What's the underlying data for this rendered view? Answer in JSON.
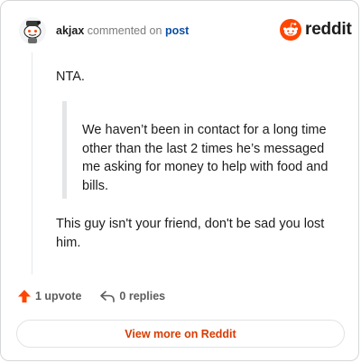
{
  "header": {
    "username": "akjax",
    "action_text": "commented on",
    "post_link": "post"
  },
  "logo": {
    "text": "reddit",
    "icon": "reddit-snoo-icon",
    "color": "#ff4500"
  },
  "comment": {
    "paragraph_1": "NTA.",
    "quote": "We haven’t been in contact for a long time other than the last 2 times he’s messaged me asking for money to help with food and bills.",
    "paragraph_2": "This guy isn't your friend, don't be sad you lost him."
  },
  "actions": {
    "upvote_icon": "upvote-arrow-icon",
    "upvote_label": "1 upvote",
    "reply_icon": "reply-arrow-icon",
    "replies_label": "0 replies"
  },
  "footer": {
    "button_label": "View more on Reddit",
    "accent_color": "#d93a00"
  }
}
